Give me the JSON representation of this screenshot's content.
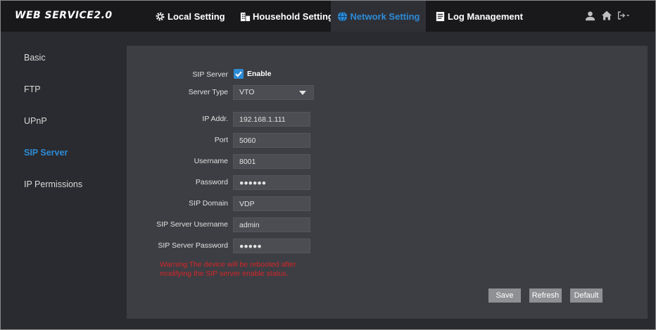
{
  "header": {
    "brand": "WEB SERVICE2.0",
    "tabs": [
      {
        "label": "Local Setting",
        "icon": "gear-icon"
      },
      {
        "label": "Household Setting",
        "icon": "building-icon"
      },
      {
        "label": "Network Setting",
        "icon": "globe-icon",
        "active": true
      },
      {
        "label": "Log Management",
        "icon": "document-icon"
      }
    ],
    "right_icons": [
      "user-icon",
      "home-icon",
      "logout-icon"
    ]
  },
  "sidebar": {
    "items": [
      {
        "label": "Basic"
      },
      {
        "label": "FTP"
      },
      {
        "label": "UPnP"
      },
      {
        "label": "SIP Server",
        "active": true
      },
      {
        "label": "IP Permissions"
      }
    ]
  },
  "form": {
    "sip_server_label": "SIP Server",
    "enable_label": "Enable",
    "enable_checked": true,
    "server_type_label": "Server Type",
    "server_type_value": "VTO",
    "ip_label": "IP Addr.",
    "ip_value": "192.168.1.111",
    "port_label": "Port",
    "port_value": "5060",
    "username_label": "Username",
    "username_value": "8001",
    "password_label": "Password",
    "password_value": "●●●●●●",
    "domain_label": "SIP Domain",
    "domain_value": "VDP",
    "server_username_label": "SIP Server Username",
    "server_username_value": "admin",
    "server_password_label": "SIP Server Password",
    "server_password_value": "●●●●●",
    "warning": "Warning:The device will be rebooted after modifying the SIP server enable status."
  },
  "buttons": {
    "save": "Save",
    "refresh": "Refresh",
    "default": "Default"
  },
  "colors": {
    "accent": "#2d8bd6",
    "warning": "#d6262a",
    "topbar": "#19191c",
    "panel": "#3d3e43"
  }
}
